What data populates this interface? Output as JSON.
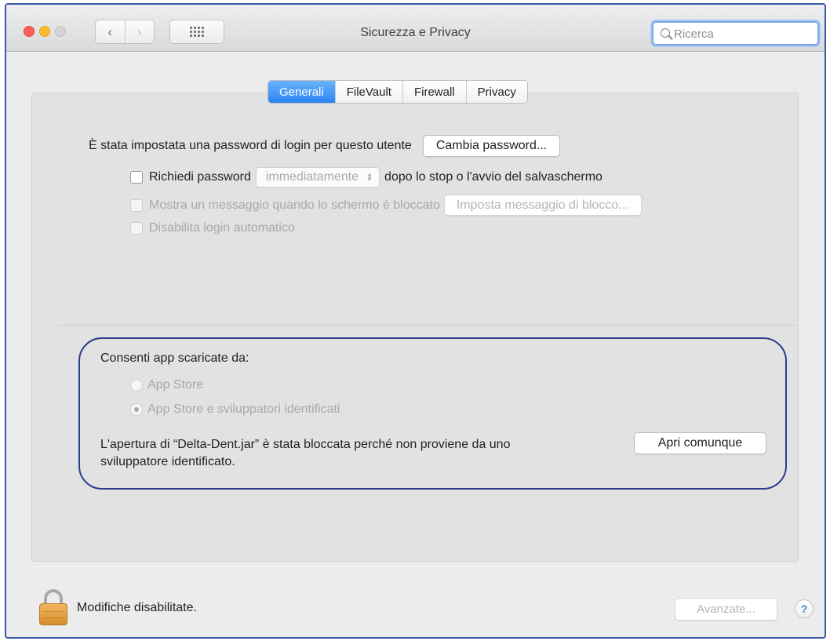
{
  "window": {
    "title": "Sicurezza e Privacy",
    "nav_back_icon": "‹",
    "nav_forward_icon": "›",
    "search": {
      "placeholder": "Ricerca",
      "value": ""
    }
  },
  "tabs": [
    {
      "label": "Generali",
      "active": true
    },
    {
      "label": "FileVault",
      "active": false
    },
    {
      "label": "Firewall",
      "active": false
    },
    {
      "label": "Privacy",
      "active": false
    }
  ],
  "general": {
    "password_status": "È stata impostata una password di login per questo utente",
    "change_password_button": "Cambia password...",
    "require_password": {
      "label": "Richiedi password",
      "checked": false,
      "popup_value": "immediatamente",
      "suffix": "dopo lo stop o l'avvio del salvaschermo"
    },
    "show_message": {
      "label": "Mostra un messaggio quando lo schermo è bloccato",
      "checked": false,
      "enabled": false,
      "button": "Imposta messaggio di blocco..."
    },
    "disable_autologin": {
      "label": "Disabilita login automatico",
      "checked": false,
      "enabled": false
    }
  },
  "gatekeeper": {
    "heading": "Consenti app scaricate da:",
    "options": [
      {
        "label": "App Store",
        "selected": false
      },
      {
        "label": "App Store e sviluppatori identificati",
        "selected": true
      }
    ],
    "blocked_message_line1": "L'apertura di “Delta-Dent.jar” è stata bloccata perché non proviene da uno",
    "blocked_message_line2": "sviluppatore identificato.",
    "open_anyway_button": "Apri comunque"
  },
  "footer": {
    "lock_status": "Modifiche disabilitate.",
    "advanced_button": "Avanzate...",
    "help_symbol": "?"
  },
  "colors": {
    "accent": "#2a84f3",
    "annotation_outline": "#2b3e8c",
    "window_frame": "#3a56a8"
  }
}
